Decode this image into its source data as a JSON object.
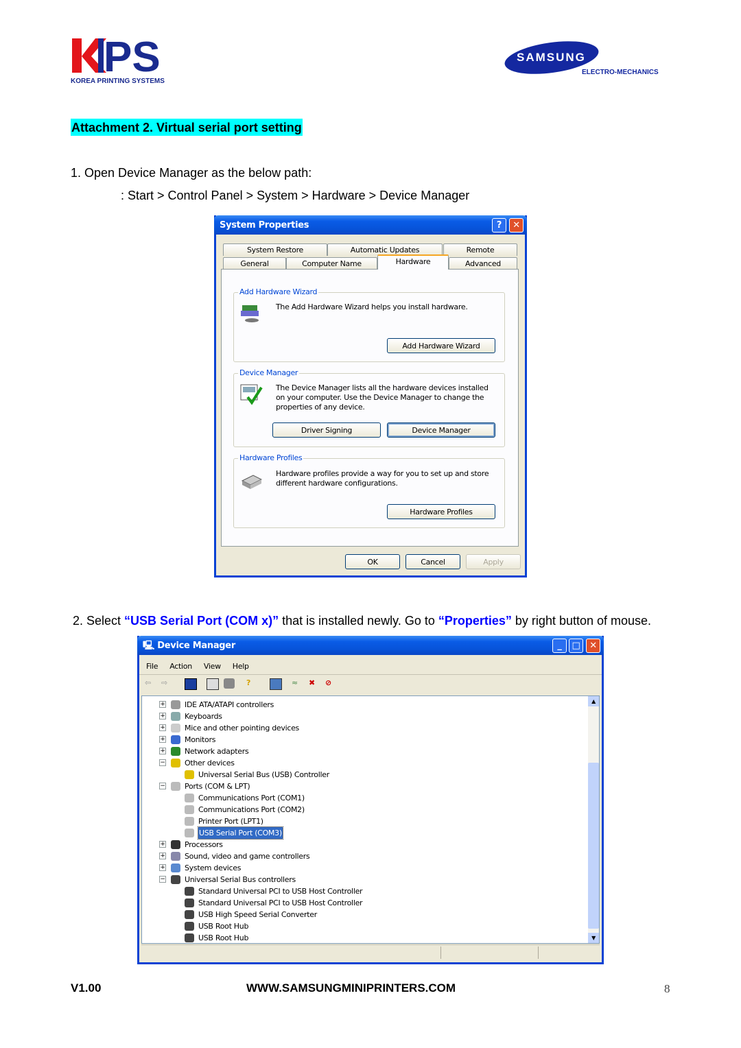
{
  "header": {
    "left_logo": {
      "text": "KPS",
      "subtitle": "KOREA PRINTING SYSTEMS"
    },
    "right_logo": {
      "text": "SAMSUNG",
      "subtitle": "ELECTRO-MECHANICS"
    }
  },
  "title": "Attachment 2. Virtual serial port setting",
  "step1": {
    "text": "1. Open Device Manager as the below path:",
    "path": ": Start > Control Panel > System > Hardware > Device Manager"
  },
  "system_properties": {
    "title": "System Properties",
    "tabs_row1": [
      "System Restore",
      "Automatic Updates",
      "Remote"
    ],
    "tabs_row2": [
      "General",
      "Computer Name",
      "Hardware",
      "Advanced"
    ],
    "active_tab": "Hardware",
    "groups": [
      {
        "label": "Add Hardware Wizard",
        "text": "The Add Hardware Wizard helps you install hardware.",
        "buttons": [
          "Add Hardware Wizard"
        ]
      },
      {
        "label": "Device Manager",
        "text": "The Device Manager lists all the hardware devices installed on your computer. Use the Device Manager to change the properties of any device.",
        "buttons": [
          "Driver Signing",
          "Device Manager"
        ]
      },
      {
        "label": "Hardware Profiles",
        "text": "Hardware profiles provide a way for you to set up and store different hardware configurations.",
        "buttons": [
          "Hardware Profiles"
        ]
      }
    ],
    "footer_buttons": [
      "OK",
      "Cancel",
      "Apply"
    ]
  },
  "step2": {
    "prefix": "2. Select ",
    "highlight1": "“USB Serial Port (COM x)”",
    "middle": " that is installed newly. Go to ",
    "highlight2": "“Properties”",
    "suffix": " by right button of mouse."
  },
  "device_manager": {
    "title": "Device Manager",
    "menu": [
      "File",
      "Action",
      "View",
      "Help"
    ],
    "tree": [
      {
        "label": "IDE ATA/ATAPI controllers",
        "level": 0,
        "expander": "+",
        "icon": "drive-icon"
      },
      {
        "label": "Keyboards",
        "level": 0,
        "expander": "+",
        "icon": "keyboard-icon"
      },
      {
        "label": "Mice and other pointing devices",
        "level": 0,
        "expander": "+",
        "icon": "mouse-icon"
      },
      {
        "label": "Monitors",
        "level": 0,
        "expander": "+",
        "icon": "monitor-icon"
      },
      {
        "label": "Network adapters",
        "level": 0,
        "expander": "+",
        "icon": "network-icon"
      },
      {
        "label": "Other devices",
        "level": 0,
        "expander": "-",
        "icon": "unknown-device-icon"
      },
      {
        "label": "Universal Serial Bus (USB) Controller",
        "level": 1,
        "icon": "warning-device-icon"
      },
      {
        "label": "Ports (COM & LPT)",
        "level": 0,
        "expander": "-",
        "icon": "port-icon"
      },
      {
        "label": "Communications Port (COM1)",
        "level": 1,
        "icon": "port-icon"
      },
      {
        "label": "Communications Port (COM2)",
        "level": 1,
        "icon": "port-icon"
      },
      {
        "label": "Printer Port (LPT1)",
        "level": 1,
        "icon": "port-icon"
      },
      {
        "label": "USB Serial Port (COM3)",
        "level": 1,
        "icon": "port-icon",
        "selected": true
      },
      {
        "label": "Processors",
        "level": 0,
        "expander": "+",
        "icon": "processor-icon"
      },
      {
        "label": "Sound, video and game controllers",
        "level": 0,
        "expander": "+",
        "icon": "sound-icon"
      },
      {
        "label": "System devices",
        "level": 0,
        "expander": "+",
        "icon": "system-icon"
      },
      {
        "label": "Universal Serial Bus controllers",
        "level": 0,
        "expander": "-",
        "icon": "usb-icon"
      },
      {
        "label": "Standard Universal PCI to USB Host Controller",
        "level": 1,
        "icon": "usb-icon"
      },
      {
        "label": "Standard Universal PCI to USB Host Controller",
        "level": 1,
        "icon": "usb-icon"
      },
      {
        "label": "USB High Speed Serial Converter",
        "level": 1,
        "icon": "usb-icon"
      },
      {
        "label": "USB Root Hub",
        "level": 1,
        "icon": "usb-icon"
      },
      {
        "label": "USB Root Hub",
        "level": 1,
        "icon": "usb-icon"
      }
    ]
  },
  "footer": {
    "version": "V1.00",
    "url": "WWW.SAMSUNGMINIPRINTERS.COM",
    "page": "8"
  },
  "colors": {
    "highlight": "#00ffff",
    "xp_title": "#0a5ce6",
    "group_label": "#0046d5",
    "link_blue": "#0000ff"
  }
}
